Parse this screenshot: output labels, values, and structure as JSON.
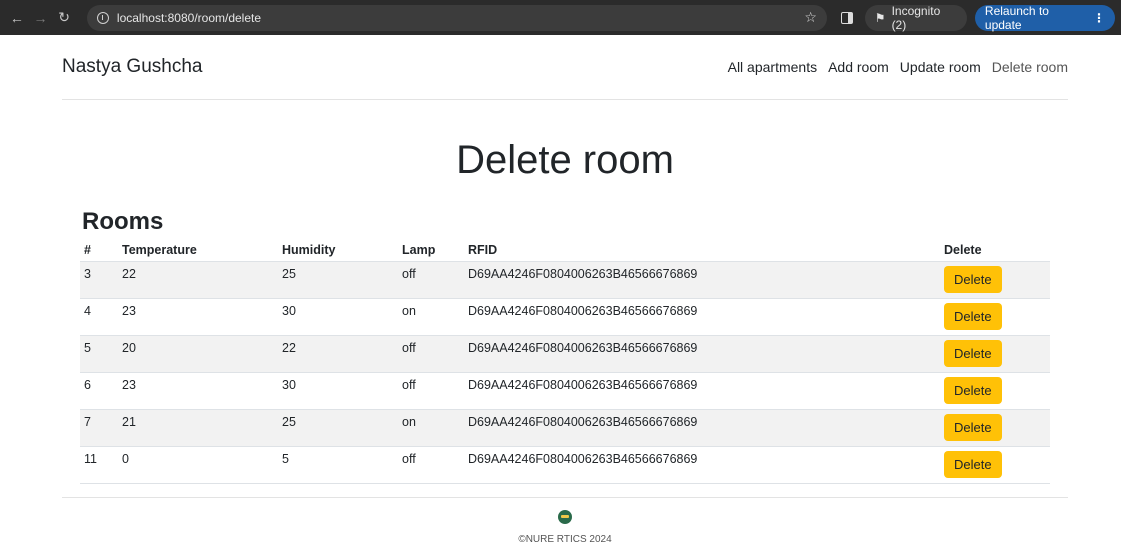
{
  "browser": {
    "url": "localhost:8080/room/delete",
    "incognito_label": "Incognito (2)",
    "relaunch_label": "Relaunch to update",
    "back_icon": "arrow-left-icon",
    "forward_icon": "arrow-right-icon",
    "reload_icon": "reload-icon"
  },
  "header": {
    "brand": "Nastya Gushcha",
    "nav": [
      {
        "label": "All apartments"
      },
      {
        "label": "Add room"
      },
      {
        "label": "Update room"
      },
      {
        "label": "Delete room"
      }
    ]
  },
  "main": {
    "title": "Delete room",
    "section_title": "Rooms",
    "table": {
      "columns": [
        "#",
        "Temperature",
        "Humidity",
        "Lamp",
        "RFID",
        "Delete"
      ],
      "rows": [
        {
          "id": "3",
          "temperature": "22",
          "humidity": "25",
          "lamp": "off",
          "rfid": "D69AA4246F0804006263B46566676869",
          "action": "Delete"
        },
        {
          "id": "4",
          "temperature": "23",
          "humidity": "30",
          "lamp": "on",
          "rfid": "D69AA4246F0804006263B46566676869",
          "action": "Delete"
        },
        {
          "id": "5",
          "temperature": "20",
          "humidity": "22",
          "lamp": "off",
          "rfid": "D69AA4246F0804006263B46566676869",
          "action": "Delete"
        },
        {
          "id": "6",
          "temperature": "23",
          "humidity": "30",
          "lamp": "off",
          "rfid": "D69AA4246F0804006263B46566676869",
          "action": "Delete"
        },
        {
          "id": "7",
          "temperature": "21",
          "humidity": "25",
          "lamp": "on",
          "rfid": "D69AA4246F0804006263B46566676869",
          "action": "Delete"
        },
        {
          "id": "11",
          "temperature": "0",
          "humidity": "5",
          "lamp": "off",
          "rfid": "D69AA4246F0804006263B46566676869",
          "action": "Delete"
        }
      ]
    }
  },
  "footer": {
    "copyright": "©NURE RTICS 2024"
  },
  "colors": {
    "delete_button": "#ffc107",
    "browser_chrome": "#2b2b2b",
    "relaunch_button": "#1f5fa8"
  }
}
